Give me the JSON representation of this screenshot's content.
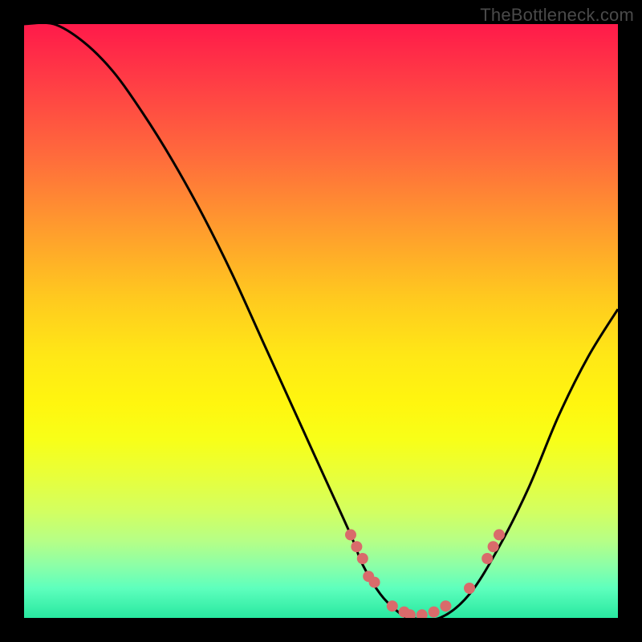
{
  "watermark": "TheBottleneck.com",
  "chart_data": {
    "type": "line",
    "title": "",
    "xlabel": "",
    "ylabel": "",
    "xlim": [
      0,
      100
    ],
    "ylim": [
      0,
      100
    ],
    "series": [
      {
        "name": "curve",
        "x": [
          0,
          5,
          10,
          15,
          20,
          25,
          30,
          35,
          40,
          45,
          50,
          55,
          57,
          60,
          63,
          65,
          70,
          75,
          80,
          85,
          90,
          95,
          100
        ],
        "y": [
          100,
          100,
          97,
          92,
          85,
          77,
          68,
          58,
          47,
          36,
          25,
          14,
          9,
          4,
          1,
          0,
          0,
          4,
          12,
          22,
          34,
          44,
          52
        ]
      }
    ],
    "markers": [
      {
        "x": 55,
        "y": 14
      },
      {
        "x": 56,
        "y": 12
      },
      {
        "x": 57,
        "y": 10
      },
      {
        "x": 58,
        "y": 7
      },
      {
        "x": 59,
        "y": 6
      },
      {
        "x": 62,
        "y": 2
      },
      {
        "x": 64,
        "y": 1
      },
      {
        "x": 65,
        "y": 0.5
      },
      {
        "x": 67,
        "y": 0.5
      },
      {
        "x": 69,
        "y": 1
      },
      {
        "x": 71,
        "y": 2
      },
      {
        "x": 75,
        "y": 5
      },
      {
        "x": 78,
        "y": 10
      },
      {
        "x": 79,
        "y": 12
      },
      {
        "x": 80,
        "y": 14
      }
    ]
  }
}
